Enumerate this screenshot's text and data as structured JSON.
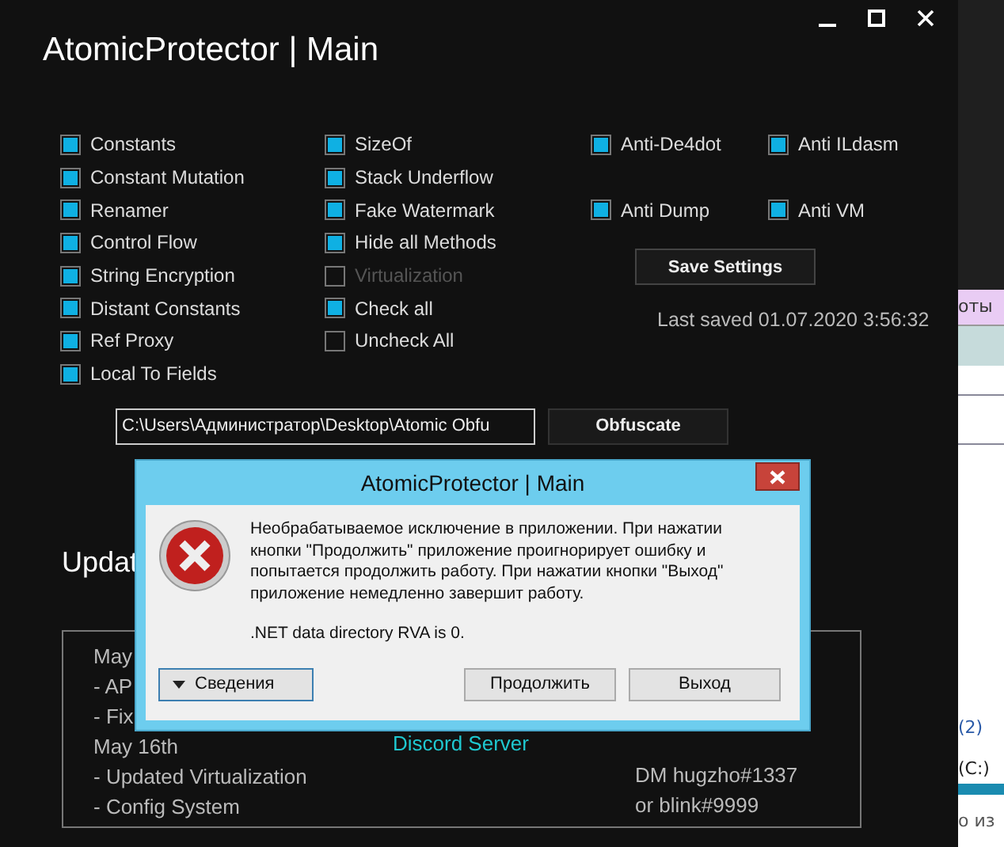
{
  "window": {
    "title": "AtomicProtector | Main"
  },
  "options": {
    "column_1": [
      {
        "label": "Constants",
        "checked": true,
        "disabled": false
      },
      {
        "label": "Constant Mutation",
        "checked": true,
        "disabled": false
      },
      {
        "label": "Renamer",
        "checked": true,
        "disabled": false
      },
      {
        "label": "Control Flow",
        "checked": true,
        "disabled": false
      },
      {
        "label": "String Encryption",
        "checked": true,
        "disabled": false
      },
      {
        "label": "Distant Constants",
        "checked": true,
        "disabled": false
      },
      {
        "label": "Ref Proxy",
        "checked": true,
        "disabled": false
      },
      {
        "label": "Local To Fields",
        "checked": true,
        "disabled": false
      }
    ],
    "column_2": [
      {
        "label": "SizeOf",
        "checked": true,
        "disabled": false
      },
      {
        "label": "Stack Underflow",
        "checked": true,
        "disabled": false
      },
      {
        "label": "Fake Watermark",
        "checked": true,
        "disabled": false
      },
      {
        "label": "Hide all Methods",
        "checked": true,
        "disabled": false
      },
      {
        "label": "Virtualization",
        "checked": false,
        "disabled": true
      },
      {
        "label": "Check all",
        "checked": true,
        "disabled": false
      },
      {
        "label": "Uncheck All",
        "checked": false,
        "disabled": false
      }
    ],
    "anti": [
      {
        "label": "Anti-De4dot",
        "checked": true,
        "disabled": false
      },
      {
        "label": "Anti ILdasm",
        "checked": true,
        "disabled": false
      },
      {
        "label": "Anti Dump",
        "checked": true,
        "disabled": false
      },
      {
        "label": "Anti VM",
        "checked": true,
        "disabled": false
      }
    ]
  },
  "save_button": "Save Settings",
  "last_saved": "Last saved 01.07.2020 3:56:32",
  "file_path": {
    "value": "C:\\Users\\Администратор\\Desktop\\Atomic Obfu"
  },
  "obfuscate_button": "Obfuscate",
  "updates_heading": "Updat",
  "changelog": {
    "left": [
      "May",
      "- AP",
      "- Fix",
      "May 16th",
      "- Updated Virtualization",
      "- Config System"
    ],
    "link": "Discord Server",
    "contact": [
      "DM hugzho#1337",
      "or blink#9999"
    ]
  },
  "dialog": {
    "title": "AtomicProtector | Main",
    "message": "Необрабатываемое исключение в приложении. При нажатии кнопки \"Продолжить\" приложение проигнорирует ошибку и попытается продолжить работу. При нажатии кнопки \"Выход\" приложение немедленно завершит работу.",
    "detail": ".NET data directory RVA is 0.",
    "details_button": "Сведения",
    "buttons": [
      "Продолжить",
      "Выход"
    ]
  },
  "background_window": {
    "texts": [
      "оты",
      "(2)",
      "(C:)",
      "о из"
    ]
  }
}
